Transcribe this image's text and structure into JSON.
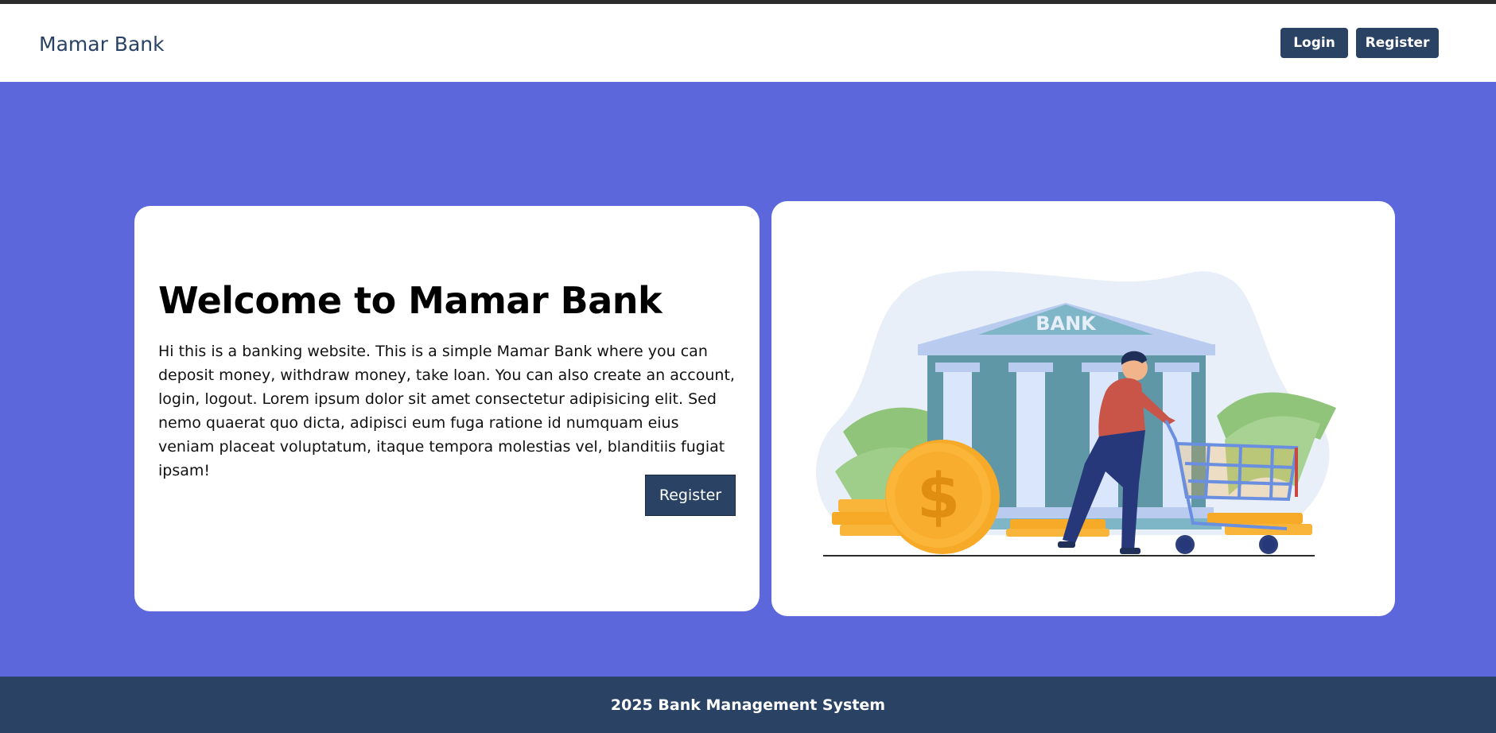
{
  "header": {
    "brand": "Mamar Bank",
    "login_label": "Login",
    "register_label": "Register"
  },
  "hero": {
    "title": "Welcome to Mamar Bank",
    "description": "Hi this is a banking website. This is a simple Mamar Bank where you can deposit money, withdraw money, take loan. You can also create an account, login, logout. Lorem ipsum dolor sit amet consectetur adipisicing elit. Sed nemo quaerat quo dicta, adipisci eum fuga ratione id numquam eius veniam placeat voluptatum, itaque tempora molestias vel, blanditiis fugiat ipsam!",
    "register_label": "Register"
  },
  "illustration": {
    "bank_sign": "BANK",
    "coin_symbol": "$"
  },
  "footer": {
    "text": "2025 Bank Management System"
  },
  "colors": {
    "page_bg": "#5b67db",
    "navy": "#2a4365",
    "card_bg": "#ffffff"
  }
}
